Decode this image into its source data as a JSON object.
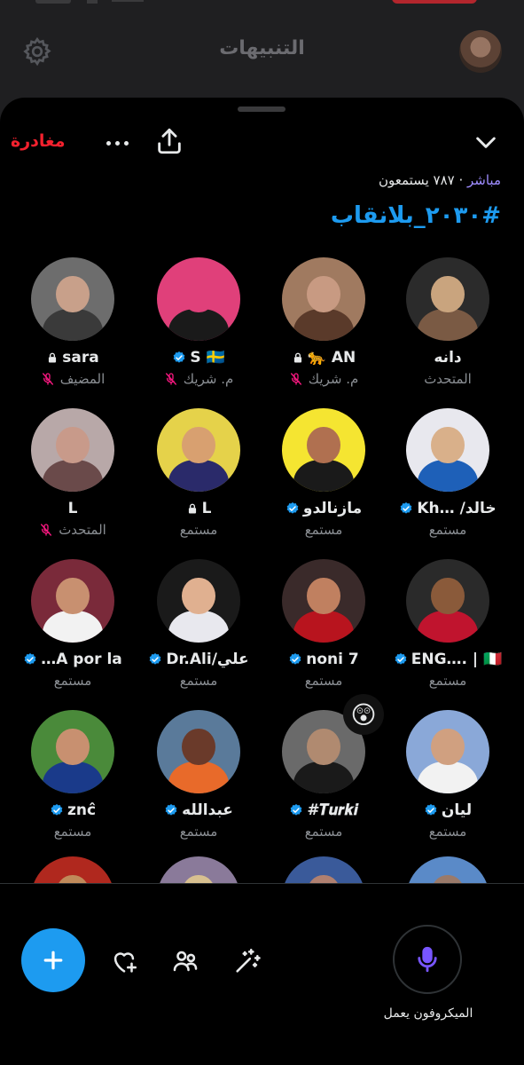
{
  "background": {
    "title": "التنبيهات",
    "gear_icon": "gear-icon"
  },
  "sheet": {
    "leave_label": "مغادرة",
    "live_label": "مباشر",
    "listeners_text": "٧٨٧ يستمعون",
    "space_title": "#٢٠٣٠_بلانقاب",
    "accent_color": "#1d9bf0",
    "leave_color": "#f4212e"
  },
  "participants": [
    {
      "name": "دانه",
      "role": "المتحدث",
      "verified": false,
      "lock": false,
      "muted": false,
      "flag": ""
    },
    {
      "name": "AN 🐆",
      "role": "م. شريك",
      "verified": false,
      "lock": true,
      "muted": true,
      "flag": ""
    },
    {
      "name": "S 🇸🇪",
      "role": "م. شريك",
      "verified": true,
      "lock": false,
      "muted": true,
      "flag": ""
    },
    {
      "name": "sara",
      "role": "المضيف",
      "verified": false,
      "lock": true,
      "muted": true,
      "flag": ""
    },
    {
      "name": "خالد/ …Kh",
      "role": "مستمع",
      "verified": true,
      "lock": false,
      "muted": false,
      "flag": ""
    },
    {
      "name": "مازنالدو",
      "role": "مستمع",
      "verified": true,
      "lock": false,
      "muted": false,
      "flag": ""
    },
    {
      "name": "L",
      "role": "مستمع",
      "verified": false,
      "lock": true,
      "muted": false,
      "flag": ""
    },
    {
      "name": "L",
      "role": "المتحدث",
      "verified": false,
      "lock": false,
      "muted": true,
      "flag": ""
    },
    {
      "name": "ENG…. | 🇮🇹",
      "role": "مستمع",
      "verified": true,
      "lock": false,
      "muted": false,
      "flag": ""
    },
    {
      "name": "noni 7",
      "role": "مستمع",
      "verified": true,
      "lock": false,
      "muted": false,
      "flag": ""
    },
    {
      "name": "علي/Dr.Ali",
      "role": "مستمع",
      "verified": true,
      "lock": false,
      "muted": false,
      "flag": ""
    },
    {
      "name": "A por la…",
      "role": "مستمع",
      "verified": true,
      "lock": false,
      "muted": false,
      "flag": ""
    },
    {
      "name": "ليان",
      "role": "مستمع",
      "verified": true,
      "lock": false,
      "muted": false,
      "flag": ""
    },
    {
      "name": "𝑻𝒖𝒓𝒌𝒊#",
      "role": "مستمع",
      "verified": true,
      "lock": false,
      "muted": false,
      "flag": "",
      "reaction": "😲"
    },
    {
      "name": "عبدالله",
      "role": "مستمع",
      "verified": true,
      "lock": false,
      "muted": false,
      "flag": ""
    },
    {
      "name": "znĉ",
      "role": "مستمع",
      "verified": true,
      "lock": false,
      "muted": false,
      "flag": ""
    }
  ],
  "bottom": {
    "mic_label": "الميكروفون يعمل",
    "fab_icon": "plus-icon",
    "tools": [
      "sparkle-wand-icon",
      "people-icon",
      "heart-plus-icon"
    ]
  }
}
